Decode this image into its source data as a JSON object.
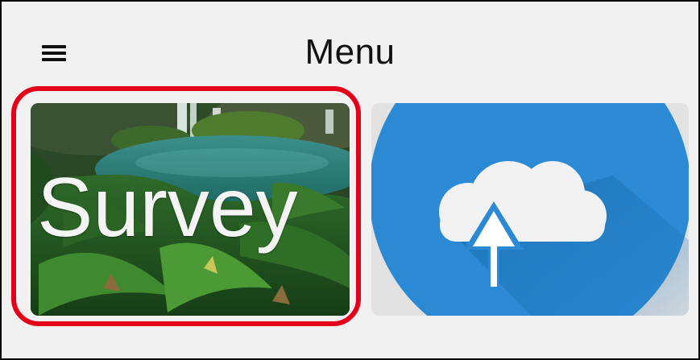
{
  "app_bar": {
    "title": "Menu",
    "menu_icon": "hamburger-menu-icon"
  },
  "tiles": [
    {
      "label": "Survey",
      "background": "waterfall-forest-photo",
      "highlighted": true,
      "highlight_color": "#e3001b"
    },
    {
      "icon": "cloud-upload-icon",
      "accent_color": "#2b8ad3",
      "cloud_color": "#f2f2f2"
    }
  ],
  "colors": {
    "background": "#f1f1f1",
    "frame_border": "#000000",
    "title_text": "#111111"
  }
}
